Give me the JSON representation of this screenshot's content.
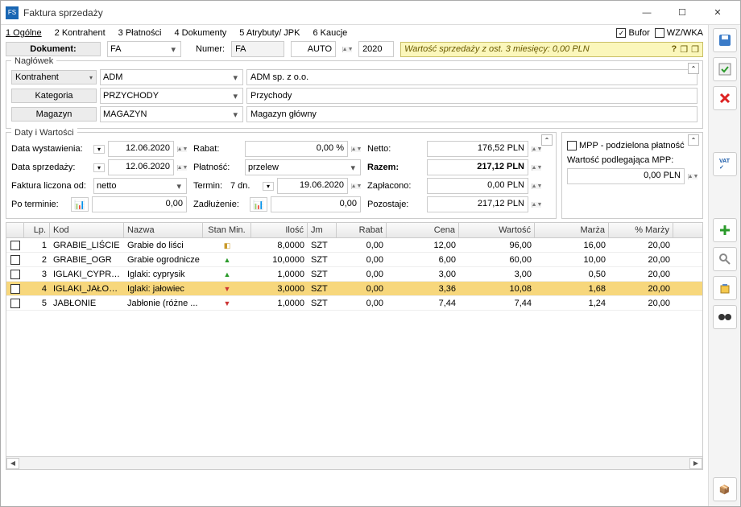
{
  "window": {
    "title": "Faktura sprzedaży"
  },
  "tabs": {
    "t1": "1 Ogólne",
    "t2": "2 Kontrahent",
    "t3": "3 Płatności",
    "t4": "4 Dokumenty",
    "t5": "5 Atrybuty/ JPK",
    "t6": "6 Kaucje"
  },
  "topchecks": {
    "bufor": "Bufor",
    "wzwka": "WZ/WKA"
  },
  "docbar": {
    "dok_lbl": "Dokument:",
    "dok_val": "FA",
    "num_lbl": "Numer:",
    "num_prefix": "FA",
    "num_auto": "AUTO",
    "num_year": "2020"
  },
  "yellow": {
    "text": "Wartość sprzedaży z ost. 3 miesięcy: 0,00 PLN",
    "q": "?",
    "i1": "❐",
    "i2": "❐"
  },
  "naglowek": {
    "title": "Nagłówek",
    "kontrahent_lbl": "Kontrahent",
    "kontrahent_code": "ADM",
    "kontrahent_name": "ADM sp. z o.o.",
    "kategoria_lbl": "Kategoria",
    "kategoria_code": "PRZYCHODY",
    "kategoria_name": "Przychody",
    "magazyn_lbl": "Magazyn",
    "magazyn_code": "MAGAZYN",
    "magazyn_name": "Magazyn główny"
  },
  "daty": {
    "title": "Daty i Wartości",
    "data_wyst_lbl": "Data wystawienia:",
    "data_wyst": "12.06.2020",
    "data_sprz_lbl": "Data sprzedaży:",
    "data_sprz": "12.06.2020",
    "faktura_liczona_lbl": "Faktura liczona od:",
    "faktura_liczona": "netto",
    "po_terminie_lbl": "Po terminie:",
    "po_terminie": "0,00",
    "rabat_lbl": "Rabat:",
    "rabat": "0,00 %",
    "platnosc_lbl": "Płatność:",
    "platnosc": "przelew",
    "termin_lbl": "Termin:",
    "termin_dni": "7 dn.",
    "termin_date": "19.06.2020",
    "zadluzenie_lbl": "Zadłużenie:",
    "zadluzenie": "0,00",
    "netto_lbl": "Netto:",
    "netto": "176,52 PLN",
    "razem_lbl": "Razem:",
    "razem": "217,12 PLN",
    "zaplacono_lbl": "Zapłacono:",
    "zaplacono": "0,00 PLN",
    "pozostaje_lbl": "Pozostaje:",
    "pozostaje": "217,12 PLN",
    "mpp_chk": "MPP - podzielona płatność",
    "mpp_lbl": "Wartość podlegająca MPP:",
    "mpp_val": "0,00 PLN"
  },
  "grid": {
    "h_lp": "Lp.",
    "h_kod": "Kod",
    "h_nazwa": "Nazwa",
    "h_stan": "Stan Min.",
    "h_ilosc": "Ilość",
    "h_jm": "Jm",
    "h_rabat": "Rabat",
    "h_cena": "Cena",
    "h_wart": "Wartość",
    "h_marza": "Marża",
    "h_pmarza": "% Marży",
    "rows": [
      {
        "lp": "1",
        "kod": "GRABIE_LIŚCIE",
        "nazwa": "Grabie do liści",
        "stan": "std",
        "ilosc": "8,0000",
        "jm": "SZT",
        "rabat": "0,00",
        "cena": "12,00",
        "wart": "96,00",
        "marza": "16,00",
        "pm": "20,00"
      },
      {
        "lp": "2",
        "kod": "GRABIE_OGR",
        "nazwa": "Grabie ogrodnicze",
        "stan": "up",
        "ilosc": "10,0000",
        "jm": "SZT",
        "rabat": "0,00",
        "cena": "6,00",
        "wart": "60,00",
        "marza": "10,00",
        "pm": "20,00"
      },
      {
        "lp": "3",
        "kod": "IGLAKI_CYPRYS",
        "nazwa": "Iglaki: cyprysik",
        "stan": "up",
        "ilosc": "1,0000",
        "jm": "SZT",
        "rabat": "0,00",
        "cena": "3,00",
        "wart": "3,00",
        "marza": "0,50",
        "pm": "20,00"
      },
      {
        "lp": "4",
        "kod": "IGLAKI_JAŁOWI...",
        "nazwa": "Iglaki: jałowiec",
        "stan": "dn",
        "ilosc": "3,0000",
        "jm": "SZT",
        "rabat": "0,00",
        "cena": "3,36",
        "wart": "10,08",
        "marza": "1,68",
        "pm": "20,00"
      },
      {
        "lp": "5",
        "kod": "JABŁONIE",
        "nazwa": "Jabłonie (różne ...",
        "stan": "dn",
        "ilosc": "1,0000",
        "jm": "SZT",
        "rabat": "0,00",
        "cena": "7,44",
        "wart": "7,44",
        "marza": "1,24",
        "pm": "20,00"
      }
    ]
  }
}
